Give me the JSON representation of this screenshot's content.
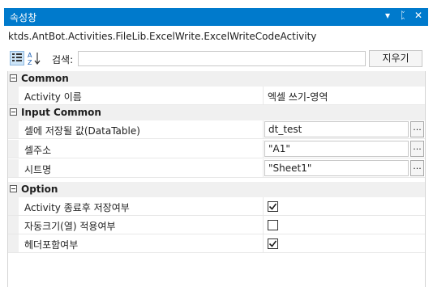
{
  "panel": {
    "title": "속성창",
    "controls": {
      "menu_glyph": "▾",
      "pin_glyph": "ᛈ",
      "close_glyph": "✕"
    },
    "subtitle": "ktds.AntBot.Activities.FileLib.ExcelWrite.ExcelWriteCodeActivity"
  },
  "toolbar": {
    "categorized_icon": "categorized-icon",
    "alphabetical_icon": "sort-alphabetical-icon",
    "search_label": "검색:",
    "search_value": "",
    "clear_label": "지우기"
  },
  "categories": [
    {
      "label": "Common",
      "properties": [
        {
          "name": "Activity 이름",
          "value": "엑셀 쓰기-영역",
          "kind": "text"
        }
      ]
    },
    {
      "label": "Input Common",
      "properties": [
        {
          "name": "셀에 저장될 값(DataTable)",
          "value": "dt_test",
          "kind": "editor",
          "button": "..."
        },
        {
          "name": "셀주소",
          "value": "\"A1\"",
          "kind": "editor",
          "button": "..."
        },
        {
          "name": "시트명",
          "value": "\"Sheet1\"",
          "kind": "editor",
          "button": "..."
        }
      ]
    },
    {
      "label": "Option",
      "properties": [
        {
          "name": "Activity 종료후 저장여부",
          "checked": true,
          "kind": "checkbox"
        },
        {
          "name": "자동크기(열) 적용여부",
          "checked": false,
          "kind": "checkbox"
        },
        {
          "name": "헤더포함여부",
          "checked": true,
          "kind": "checkbox"
        }
      ]
    }
  ],
  "colors": {
    "titlebar": "#007acc",
    "category_bg": "#f0f0f0"
  }
}
